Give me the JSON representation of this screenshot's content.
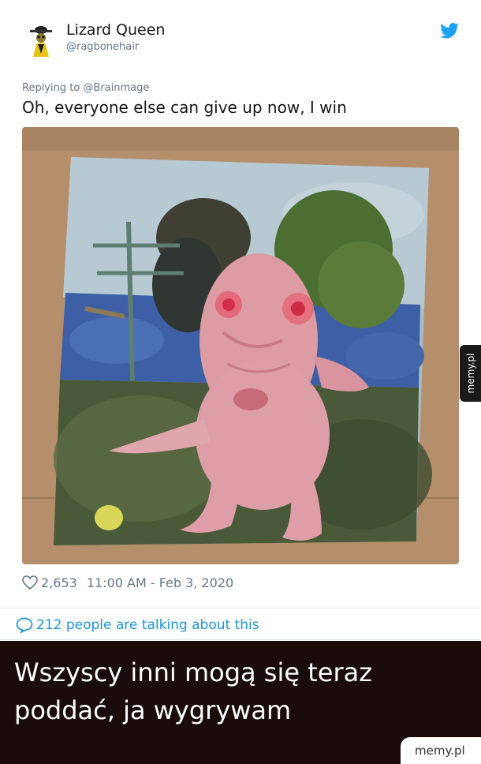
{
  "tweet": {
    "display_name": "Lizard Queen",
    "handle": "@ragbonehair",
    "replying_to": "Replying to @Brainmage",
    "text": "Oh, everyone else can give up now, I win",
    "likes": "2,653",
    "timestamp": "11:00 AM - Feb 3, 2020",
    "talking": "212 people are talking about this",
    "avatar_icon": "lizard-avatar-icon",
    "brand_icon": "twitter-bird-icon",
    "brand_color": "#1da1f2"
  },
  "media": {
    "description_icon": "painting-of-pink-creature"
  },
  "watermark": {
    "side_label": "memy.pl",
    "footer_label": "memy.pl"
  },
  "caption": {
    "text": "Wszyscy inni mogą się teraz poddać, ja wygrywam"
  }
}
